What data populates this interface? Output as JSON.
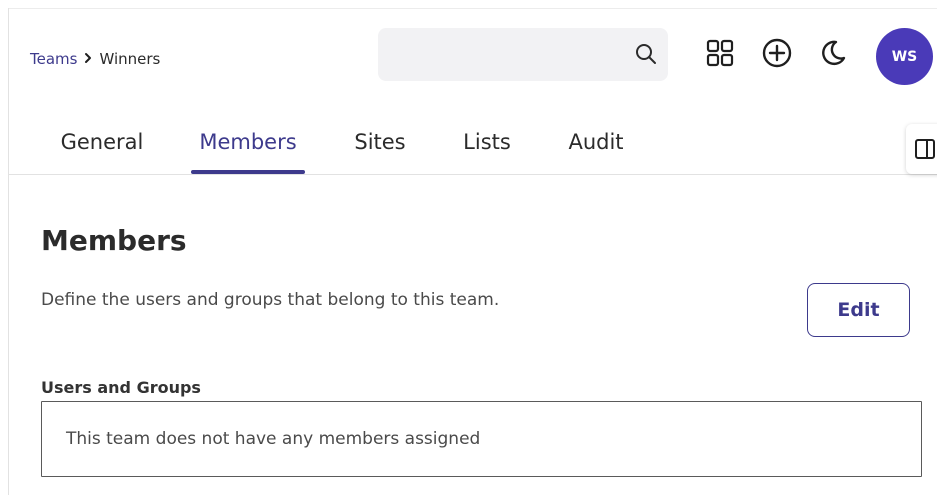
{
  "breadcrumb": {
    "parent": "Teams",
    "separator": "›",
    "current": "Winners"
  },
  "header": {
    "search": {
      "placeholder": "",
      "icon": "search-icon"
    },
    "apps_icon": "grid-icon",
    "add_icon": "plus-circle-icon",
    "theme_icon": "moon-icon",
    "avatar_initials": "WS",
    "avatar_color": "#4a3ab8"
  },
  "tabs": [
    {
      "label": "General",
      "active": false
    },
    {
      "label": "Members",
      "active": true
    },
    {
      "label": "Sites",
      "active": false
    },
    {
      "label": "Lists",
      "active": false
    },
    {
      "label": "Audit",
      "active": false
    }
  ],
  "side_panel_toggle_icon": "panel-toggle-icon",
  "members": {
    "title": "Members",
    "description": "Define the users and groups that belong to this team.",
    "edit_label": "Edit",
    "field_label": "Users and Groups",
    "empty_message": "This team does not have any members assigned"
  },
  "colors": {
    "accent": "#3d3a8c",
    "search_bg": "#f2f2f4"
  }
}
